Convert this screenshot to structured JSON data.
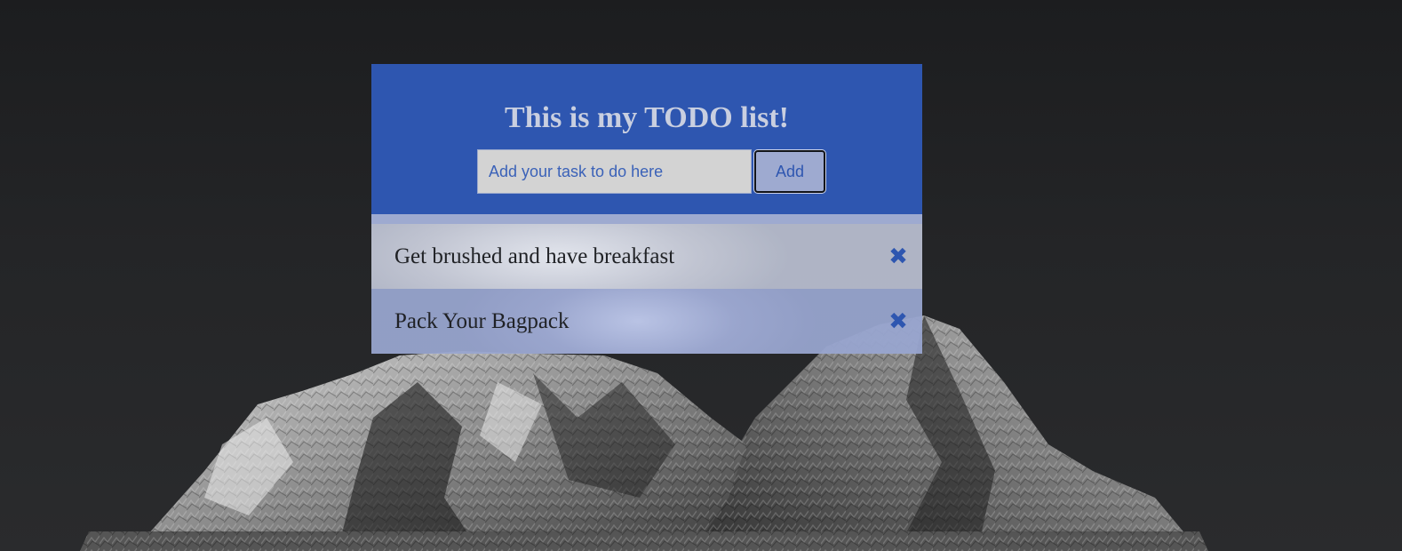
{
  "todo": {
    "title": "This is my TODO list!",
    "input_placeholder": "Add your task to do here",
    "input_value": "",
    "add_label": "Add",
    "items": [
      {
        "text": "Get brushed and have breakfast",
        "delete_icon": "✖"
      },
      {
        "text": "Pack Your Bagpack",
        "delete_icon": "✖"
      }
    ]
  },
  "colors": {
    "header_bg": "#2e56b0",
    "accent": "#2e56b0",
    "title_text": "#c9cfe0",
    "item_light": "#cdd1dd",
    "item_dark": "#9eaad0"
  },
  "background": {
    "icon": "mountain-peaks-image"
  }
}
